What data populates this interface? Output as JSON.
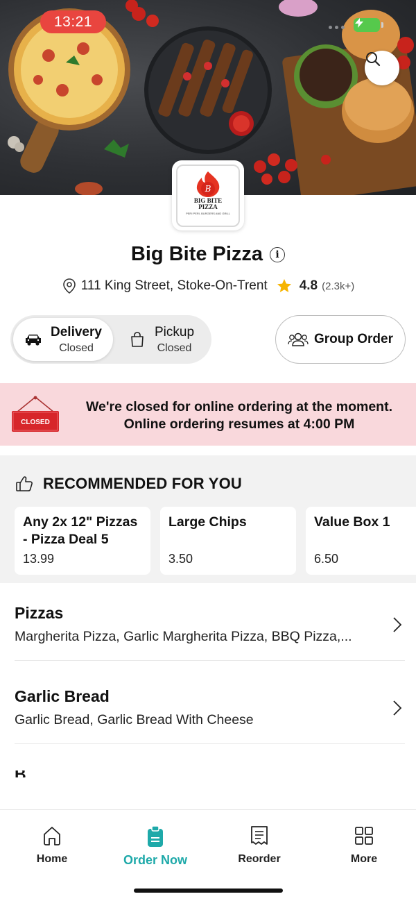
{
  "status_bar": {
    "time": "13:21"
  },
  "store": {
    "name": "Big Bite Pizza",
    "address": "111 King Street, Stoke-On-Trent",
    "rating": "4.8",
    "rating_count": "(2.3k+)",
    "logo": {
      "letter": "B",
      "word_line1": "BIG BITE",
      "word_line2": "PIZZA",
      "tagline": "PERI PERI, BURGERS AND GRILL"
    }
  },
  "order_mode": {
    "delivery": {
      "label": "Delivery",
      "status": "Closed",
      "selected": true
    },
    "pickup": {
      "label": "Pickup",
      "status": "Closed",
      "selected": false
    }
  },
  "group_order": {
    "label": "Group Order"
  },
  "closed_banner": {
    "sign_text": "CLOSED",
    "line1": "We're closed for online ordering at the moment.",
    "line2": "Online ordering resumes at 4:00 PM"
  },
  "recommended": {
    "heading": "RECOMMENDED FOR YOU",
    "items": [
      {
        "name": "Any 2x 12\" Pizzas - Pizza Deal 5",
        "price": "13.99"
      },
      {
        "name": "Large Chips",
        "price": "3.50"
      },
      {
        "name": "Value Box 1",
        "price": "6.50"
      }
    ]
  },
  "categories": [
    {
      "title": "Pizzas",
      "items": "Margherita Pizza, Garlic Margherita Pizza, BBQ Pizza,..."
    },
    {
      "title": "Garlic Bread",
      "items": "Garlic Bread, Garlic Bread With Cheese"
    },
    {
      "title": "B",
      "items": ""
    }
  ],
  "bottom_nav": {
    "items": [
      {
        "label": "Home",
        "icon": "home-icon",
        "active": false
      },
      {
        "label": "Order Now",
        "icon": "order-now-icon",
        "active": true
      },
      {
        "label": "Reorder",
        "icon": "receipt-icon",
        "active": false
      },
      {
        "label": "More",
        "icon": "grid-icon",
        "active": false
      }
    ],
    "active_color": "#1ea9a9"
  },
  "colors": {
    "closed_banner_bg": "#f9d8dc",
    "time_pill": "#e9453f",
    "star": "#f6b400"
  }
}
